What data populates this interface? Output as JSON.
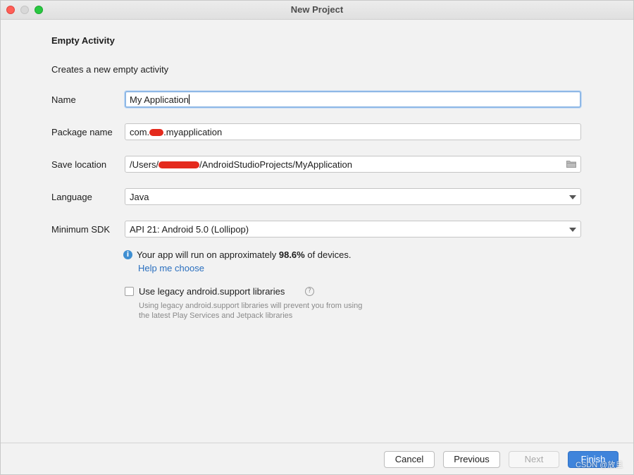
{
  "window": {
    "title": "New Project"
  },
  "form": {
    "heading": "Empty Activity",
    "description": "Creates a new empty activity",
    "name": {
      "label": "Name",
      "value": "My Application"
    },
    "package": {
      "label": "Package name",
      "prefix": "com.",
      "suffix": ".myapplication"
    },
    "save_location": {
      "label": "Save location",
      "prefix": "/Users/",
      "suffix": "/AndroidStudioProjects/MyApplication"
    },
    "language": {
      "label": "Language",
      "selected": "Java"
    },
    "min_sdk": {
      "label": "Minimum SDK",
      "selected": "API 21: Android 5.0 (Lollipop)"
    },
    "info": {
      "before": "Your app will run on approximately ",
      "percent": "98.6%",
      "after": " of devices."
    },
    "help_link": "Help me choose",
    "legacy": {
      "label": "Use legacy android.support libraries",
      "checked": false,
      "hint_line1": "Using legacy android.support libraries will prevent you from using",
      "hint_line2": "the latest Play Services and Jetpack libraries"
    }
  },
  "buttons": {
    "cancel": "Cancel",
    "previous": "Previous",
    "next": "Next",
    "finish": "Finish"
  },
  "watermark": "CSDN @放且",
  "icons": {
    "info": "info-icon",
    "folder": "folder-icon",
    "help": "question-icon",
    "dropdown": "chevron-down-icon"
  },
  "colors": {
    "accent": "#3f84db",
    "link": "#2a6fbf",
    "redaction": "#e42a1d"
  }
}
